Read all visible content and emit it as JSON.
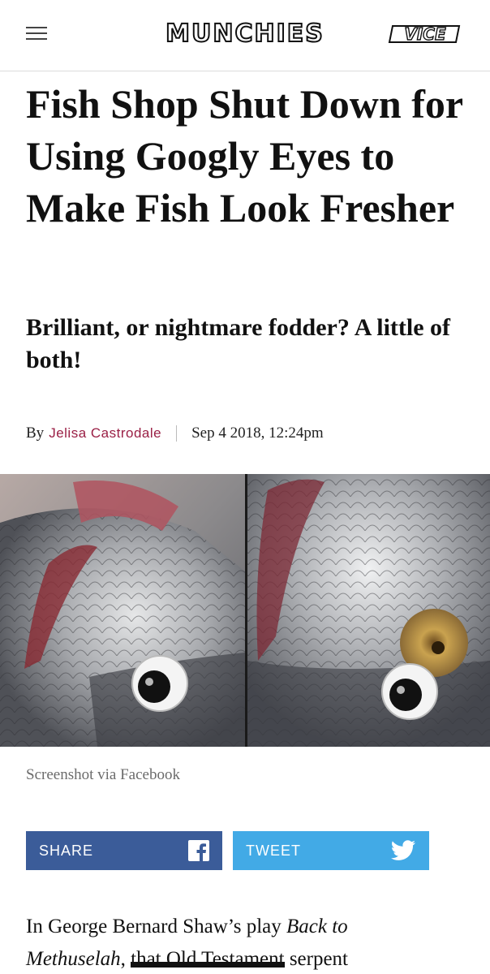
{
  "header": {
    "logo": "MUNCHIES",
    "brand": "VICE"
  },
  "article": {
    "headline": "Fish Shop Shut Down for Using Googly Eyes to Make Fish Look Fresher",
    "dek": "Brilliant, or nightmare fodder? A little of both!",
    "byline_prefix": "By",
    "author": "Jelisa Castrodale",
    "date": "Sep 4 2018, 12:24pm",
    "image_caption": "Screenshot via Facebook",
    "body_start": "In George Bernard Shaw’s play ",
    "body_italic_1": "Back to",
    "body_italic_2": "Methuselah",
    "body_comma": ", ",
    "body_struck": "that Old Testament",
    "body_end": " serpent"
  },
  "share": {
    "share_label": "SHARE",
    "tweet_label": "TWEET"
  },
  "icons": [
    "menu-icon",
    "facebook-icon",
    "twitter-icon"
  ],
  "colors": {
    "author": "#9a1f45",
    "share_bg": "#3b5c99",
    "tweet_bg": "#42aae6"
  }
}
